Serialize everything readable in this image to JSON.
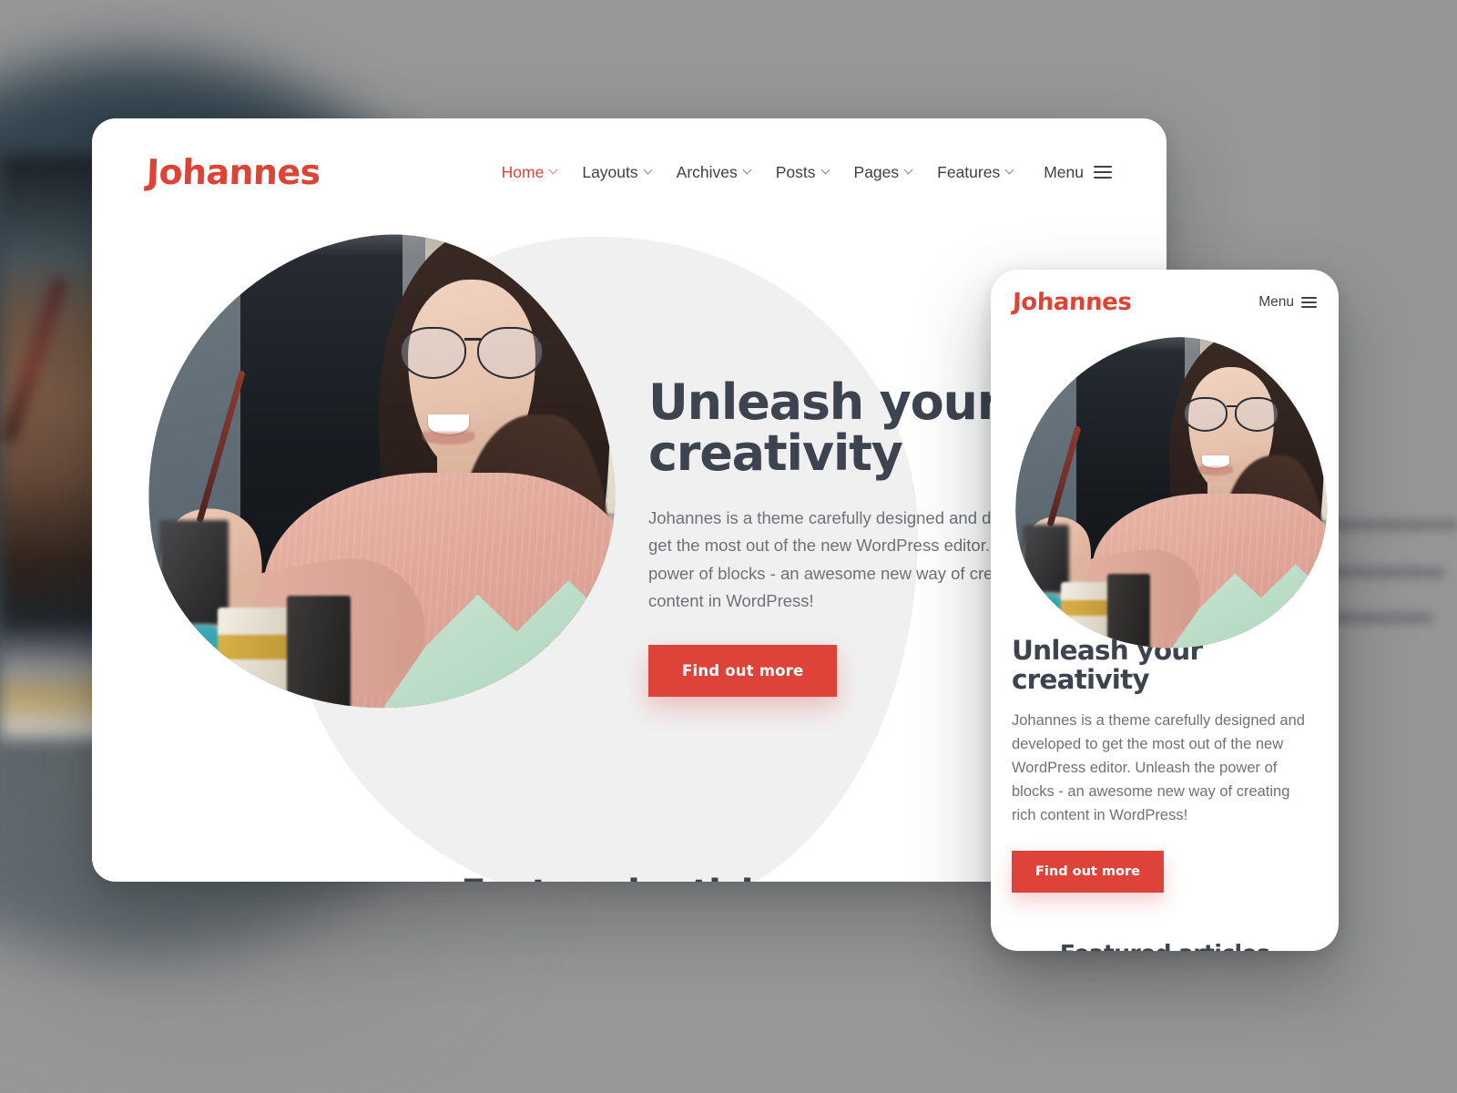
{
  "background": {
    "base_color": "#979797",
    "blob_color": "#32424c"
  },
  "theme": {
    "accent_color": "#de4339",
    "logo_color": "#dd4436",
    "heading_color": "#3d4450",
    "body_text_color": "#6d7278",
    "hero_blob_color": "#f0f0f0"
  },
  "desktop": {
    "logo": "Johannes",
    "nav": [
      {
        "label": "Home",
        "has_chevron": true,
        "active": true
      },
      {
        "label": "Layouts",
        "has_chevron": true,
        "active": false
      },
      {
        "label": "Archives",
        "has_chevron": true,
        "active": false
      },
      {
        "label": "Posts",
        "has_chevron": true,
        "active": false
      },
      {
        "label": "Pages",
        "has_chevron": true,
        "active": false
      },
      {
        "label": "Features",
        "has_chevron": true,
        "active": false
      },
      {
        "label": "Menu",
        "has_chevron": false,
        "active": false,
        "icon": "hamburger-icon"
      }
    ],
    "hero": {
      "heading": "Unleash your creativity",
      "paragraph": "Johannes is a theme carefully designed and developed to get the most out of the new WordPress editor. Unleash the power of blocks - an awesome new way of creating rich content in WordPress!",
      "button_label": "Find out more",
      "image_alt": "woman-with-glasses-painting-icon"
    },
    "featured": {
      "title": "Featured articles"
    }
  },
  "mobile": {
    "logo": "Johannes",
    "menu_label": "Menu",
    "menu_icon": "hamburger-icon",
    "hero": {
      "heading": "Unleash your creativity",
      "paragraph": "Johannes is a theme carefully designed and developed to get the most out of the new WordPress editor. Unleash the power of blocks - an awesome new way of creating rich content in WordPress!",
      "button_label": "Find out more",
      "image_alt": "woman-with-glasses-painting-icon"
    },
    "featured": {
      "title": "Featured articles"
    }
  }
}
